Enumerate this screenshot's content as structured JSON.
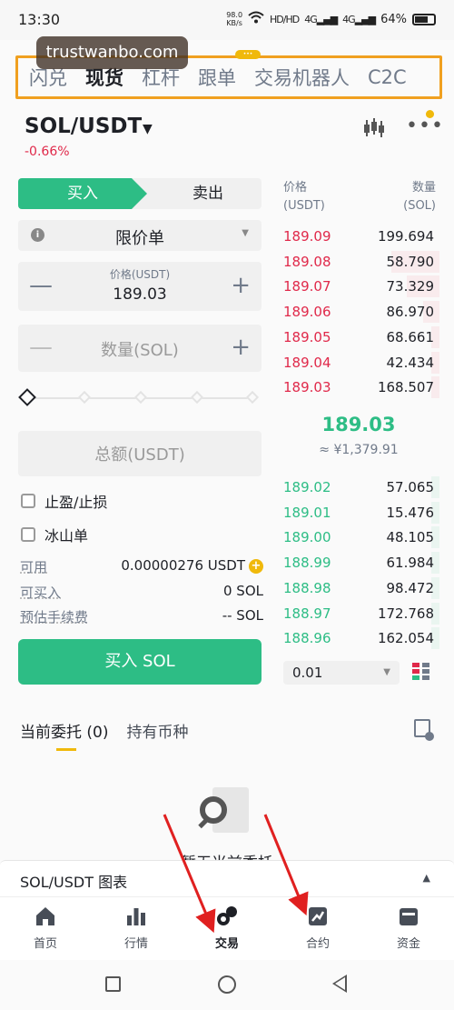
{
  "status_bar": {
    "time": "13:30",
    "net_speed_value": "98.0",
    "net_speed_unit": "KB/s",
    "hd1": "HD",
    "hd2": "HD",
    "sig1": "4G",
    "sig2": "4G",
    "battery": "64%"
  },
  "watermark": "trustwanbo.com",
  "top_tabs": [
    "闪兑",
    "现货",
    "杠杆",
    "跟单",
    "交易机器人",
    "C2C"
  ],
  "pair": {
    "symbol": "SOL/USDT",
    "change": "-0.66%"
  },
  "trade_form": {
    "buy_label": "买入",
    "sell_label": "卖出",
    "order_type": "限价单",
    "price_label": "价格(USDT)",
    "price_value": "189.03",
    "qty_placeholder": "数量(SOL)",
    "total_placeholder": "总额(USDT)",
    "tp_sl_label": "止盈/止损",
    "iceberg_label": "冰山单",
    "available_label": "可用",
    "available_value": "0.00000276 USDT",
    "can_buy_label": "可买入",
    "can_buy_value": "0 SOL",
    "fee_label": "预估手续费",
    "fee_value": "-- SOL",
    "submit_label": "买入 SOL",
    "slider_percent": 0
  },
  "order_book": {
    "price_header": "价格",
    "price_unit": "(USDT)",
    "qty_header": "数量",
    "qty_unit": "(SOL)",
    "asks": [
      {
        "price": "189.09",
        "qty": "199.694",
        "depth": 0.0
      },
      {
        "price": "189.08",
        "qty": "58.790",
        "depth": 0.3
      },
      {
        "price": "189.07",
        "qty": "73.329",
        "depth": 0.2
      },
      {
        "price": "189.06",
        "qty": "86.970",
        "depth": 0.1
      },
      {
        "price": "189.05",
        "qty": "68.661",
        "depth": 0.05
      },
      {
        "price": "189.04",
        "qty": "42.434",
        "depth": 0.05
      },
      {
        "price": "189.03",
        "qty": "168.507",
        "depth": 0.05
      }
    ],
    "mid_price": "189.03",
    "mid_fiat": "≈ ¥1,379.91",
    "bids": [
      {
        "price": "189.02",
        "qty": "57.065",
        "depth": 0.05
      },
      {
        "price": "189.01",
        "qty": "15.476",
        "depth": 0.05
      },
      {
        "price": "189.00",
        "qty": "48.105",
        "depth": 0.05
      },
      {
        "price": "188.99",
        "qty": "61.984",
        "depth": 0.05
      },
      {
        "price": "188.98",
        "qty": "98.472",
        "depth": 0.05
      },
      {
        "price": "188.97",
        "qty": "172.768",
        "depth": 0.05
      },
      {
        "price": "188.96",
        "qty": "162.054",
        "depth": 0.05
      }
    ],
    "depth_step": "0.01"
  },
  "lower_tabs": {
    "open_orders": "当前委托 (0)",
    "holdings": "持有币种"
  },
  "empty_state": "暂无当前委托",
  "chart_bar": {
    "label": "SOL/USDT 图表"
  },
  "bottom_nav": [
    "首页",
    "行情",
    "交易",
    "合约",
    "资金"
  ],
  "colors": {
    "buy_green": "#2dbd85",
    "sell_red": "#e0294a",
    "accent_yellow": "#f0b90b",
    "highlight_box": "#f0a020",
    "annotation_arrow": "#e02020"
  }
}
